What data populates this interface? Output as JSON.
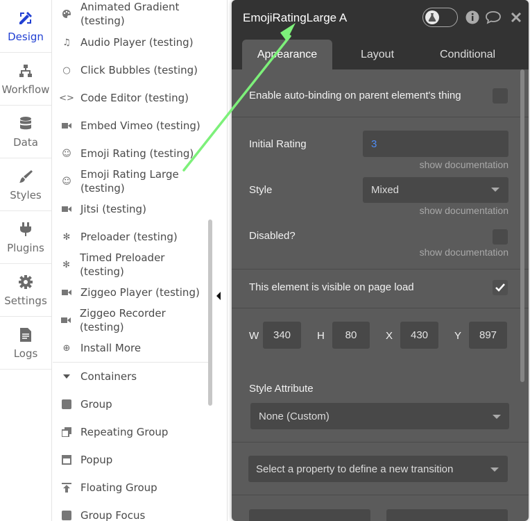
{
  "nav": {
    "items": [
      {
        "label": "Design",
        "icon": "design-icon"
      },
      {
        "label": "Workflow",
        "icon": "workflow-icon"
      },
      {
        "label": "Data",
        "icon": "database-icon"
      },
      {
        "label": "Styles",
        "icon": "brush-icon"
      },
      {
        "label": "Plugins",
        "icon": "plug-icon"
      },
      {
        "label": "Settings",
        "icon": "gear-icon"
      },
      {
        "label": "Logs",
        "icon": "document-icon"
      }
    ],
    "active_color": "#2140d3"
  },
  "elements": {
    "items": [
      {
        "label": "Animated Gradient (testing)",
        "icon": "palette-icon",
        "glyph": "🎨"
      },
      {
        "label": "Audio Player (testing)",
        "icon": "music-icon",
        "glyph": "♫"
      },
      {
        "label": "Click Bubbles (testing)",
        "icon": "circle-icon",
        "glyph": "○"
      },
      {
        "label": "Code Editor (testing)",
        "icon": "code-icon",
        "glyph": "<>"
      },
      {
        "label": "Embed Vimeo (testing)",
        "icon": "video-icon",
        "glyph": "▶"
      },
      {
        "label": "Emoji Rating (testing)",
        "icon": "smiley-icon",
        "glyph": "☺"
      },
      {
        "label": "Emoji Rating Large (testing)",
        "icon": "smiley-icon",
        "glyph": "☺"
      },
      {
        "label": "Jitsi (testing)",
        "icon": "video-icon",
        "glyph": "▶"
      },
      {
        "label": "Preloader (testing)",
        "icon": "spinner-icon",
        "glyph": "✻"
      },
      {
        "label": "Timed Preloader (testing)",
        "icon": "spinner-icon",
        "glyph": "✻"
      },
      {
        "label": "Ziggeo Player (testing)",
        "icon": "video-icon",
        "glyph": "▶"
      },
      {
        "label": "Ziggeo Recorder (testing)",
        "icon": "video-icon",
        "glyph": "▶"
      },
      {
        "label": "Install More",
        "icon": "plus-circle-icon",
        "glyph": "⊕"
      }
    ],
    "containers_label": "Containers",
    "containers": [
      {
        "label": "Group",
        "icon": "square-icon",
        "glyph": "■"
      },
      {
        "label": "Repeating Group",
        "icon": "stack-icon",
        "glyph": "❐"
      },
      {
        "label": "Popup",
        "icon": "window-icon",
        "glyph": "▣"
      },
      {
        "label": "Floating Group",
        "icon": "upload-icon",
        "glyph": "⤒"
      },
      {
        "label": "Group Focus",
        "icon": "square-icon",
        "glyph": "■"
      }
    ]
  },
  "editor": {
    "title": "EmojiRatingLarge A",
    "tabs": [
      "Appearance",
      "Layout",
      "Conditional"
    ],
    "auto_binding_label": "Enable auto-binding on parent element's thing",
    "initial_rating_label": "Initial Rating",
    "initial_rating_value": "3",
    "show_docs": "show documentation",
    "style_label": "Style",
    "style_value": "Mixed",
    "disabled_label": "Disabled?",
    "visible_label": "This element is visible on page load",
    "dims": {
      "w_label": "W",
      "w": "340",
      "h_label": "H",
      "h": "80",
      "x_label": "X",
      "x": "430",
      "y_label": "Y",
      "y": "897"
    },
    "style_attr_label": "Style Attribute",
    "style_attr_value": "None (Custom)",
    "transition_placeholder": "Select a property to define a new transition"
  },
  "colors": {
    "panel": "#5b5b5b",
    "header": "#333333",
    "link_value": "#4f8df5",
    "annotation_arrow": "#7df07a"
  }
}
